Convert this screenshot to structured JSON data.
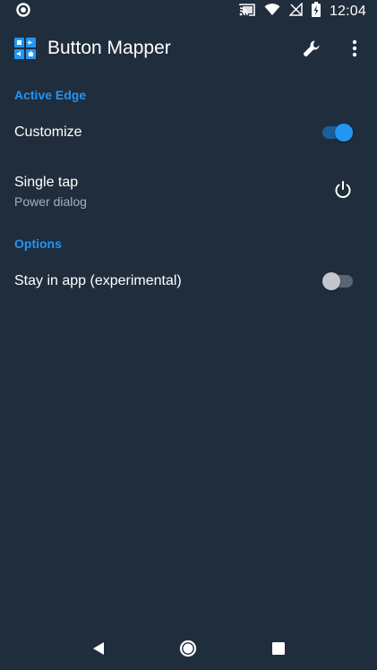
{
  "status_bar": {
    "time": "12:04",
    "icons": [
      "notification-circle-icon",
      "cast-icon",
      "wifi-icon",
      "signal-off-icon",
      "battery-charging-icon"
    ]
  },
  "app_bar": {
    "title": "Button Mapper",
    "icons": [
      "app-logo-icon",
      "wrench-icon",
      "overflow-menu-icon"
    ]
  },
  "sections": [
    {
      "header": "Active Edge",
      "items": [
        {
          "title": "Customize",
          "control": "switch",
          "checked": true
        },
        {
          "title": "Single tap",
          "summary": "Power dialog",
          "icon": "power-icon"
        }
      ]
    },
    {
      "header": "Options",
      "items": [
        {
          "title": "Stay in app (experimental)",
          "control": "switch",
          "checked": false
        }
      ]
    }
  ],
  "nav_bar": {
    "icons": [
      "back-icon",
      "home-icon",
      "recents-icon"
    ]
  },
  "colors": {
    "background": "#1f2d3d",
    "accent": "#2196f3",
    "secondary_text": "#a6b0bb"
  }
}
